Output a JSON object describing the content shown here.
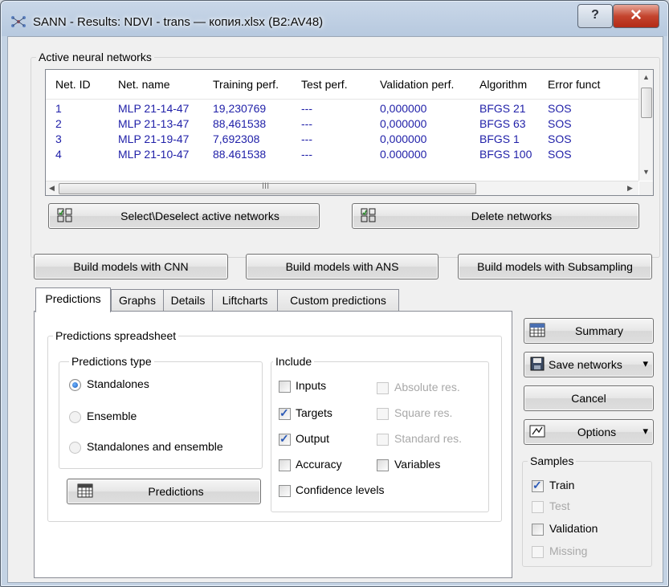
{
  "window": {
    "title": "SANN - Results: NDVI - trans — копия.xlsx (B2:AV48)"
  },
  "active_networks": {
    "label": "Active neural networks",
    "columns": [
      "Net. ID",
      "Net. name",
      "Training perf.",
      "Test perf.",
      "Validation perf.",
      "Algorithm",
      "Error funct"
    ],
    "rows": [
      [
        "1",
        "MLP 21-14-47",
        "19,230769",
        "---",
        "0,000000",
        "BFGS 21",
        "SOS"
      ],
      [
        "2",
        "MLP 21-13-47",
        "88,461538",
        "---",
        "0,000000",
        "BFGS 63",
        "SOS"
      ],
      [
        "3",
        "MLP 21-19-47",
        "7,692308",
        "---",
        "0,000000",
        "BFGS 1",
        "SOS"
      ],
      [
        "4",
        "MLP 21-10-47",
        "88,461538",
        "---",
        "0,000000",
        "BFGS 100",
        "SOS"
      ]
    ],
    "scroll_thumb_glyph": "III",
    "select_deselect": "Select\\Deselect active networks",
    "delete_networks": "Delete networks"
  },
  "build_buttons": {
    "cnn": "Build models with CNN",
    "ans": "Build  models with ANS",
    "subsampling": "Build models with Subsampling"
  },
  "tabs": [
    "Predictions",
    "Graphs",
    "Details",
    "Liftcharts",
    "Custom predictions"
  ],
  "predictions": {
    "spreadsheet_label": "Predictions spreadsheet",
    "type_label": "Predictions type",
    "types": [
      "Standalones",
      "Ensemble",
      "Standalones and ensemble"
    ],
    "selected_type": "Standalones",
    "include_label": "Include",
    "include": {
      "inputs": "Inputs",
      "targets": "Targets",
      "output": "Output",
      "accuracy": "Accuracy",
      "confidence": "Confidence levels",
      "absolute_res": "Absolute res.",
      "square_res": "Square res.",
      "standard_res": "Standard res.",
      "variables": "Variables"
    },
    "predictions_button": "Predictions"
  },
  "side": {
    "summary": "Summary",
    "save_networks": "Save networks",
    "cancel": "Cancel",
    "options": "Options",
    "samples_label": "Samples",
    "samples": {
      "train": "Train",
      "test": "Test",
      "validation": "Validation",
      "missing": "Missing"
    },
    "dropdown_glyph": "▾"
  },
  "colors": {
    "grid_text": "#1f1fa8",
    "check_mark": "#2a59b6"
  }
}
